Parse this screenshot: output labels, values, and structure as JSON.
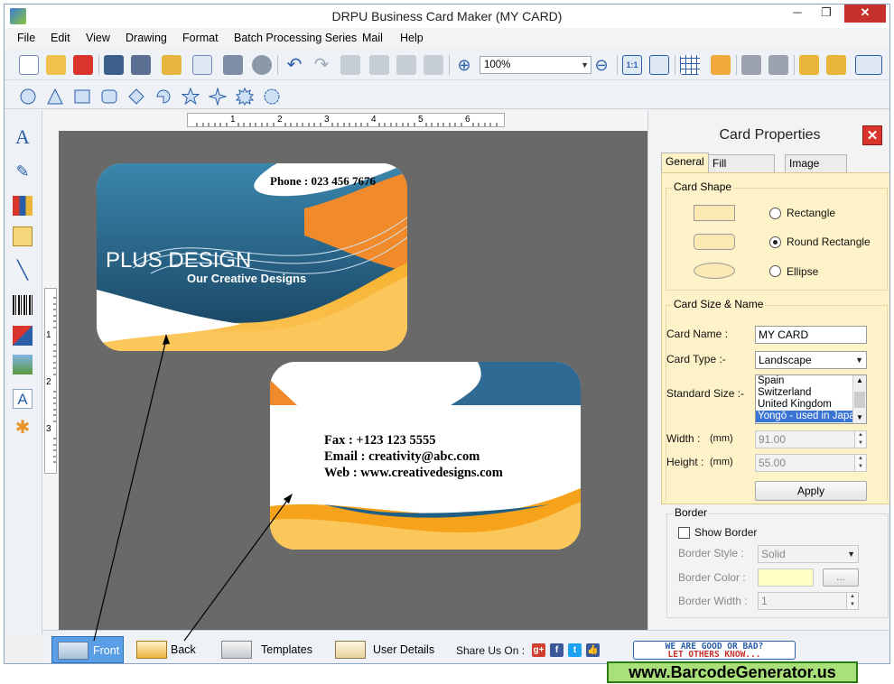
{
  "window": {
    "title": "DRPU Business Card Maker (MY CARD)",
    "minimize": "─",
    "maximize": "❐",
    "close": "✕"
  },
  "menu": [
    "File",
    "Edit",
    "View",
    "Drawing",
    "Format",
    "Batch Processing Series",
    "Mail",
    "Help"
  ],
  "toolbar": {
    "zoom_value": "100%"
  },
  "canvas": {
    "ruler_top_numbers": [
      "1",
      "2",
      "3",
      "4",
      "5",
      "6"
    ],
    "ruler_left_numbers": [
      "1",
      "2",
      "3"
    ],
    "front_card": {
      "phone": "Phone : 023 456 7676",
      "company": "PLUS DESIGN",
      "tagline": "Our Creative Designs"
    },
    "back_card": {
      "fax": "Fax : +123 123 5555",
      "email": "Email : creativity@abc.com",
      "web": "Web : www.creativedesigns.com"
    }
  },
  "properties": {
    "title": "Card Properties",
    "close": "✕",
    "tabs": [
      "General",
      "Fill Background",
      "Image Processing"
    ],
    "card_shape": {
      "label": "Card Shape",
      "options": [
        "Rectangle",
        "Round Rectangle",
        "Ellipse"
      ],
      "selected": "Round Rectangle"
    },
    "size_name": {
      "label": "Card Size & Name",
      "card_name_label": "Card Name :",
      "card_name_value": "MY CARD",
      "card_type_label": "Card Type :-",
      "card_type_value": "Landscape",
      "standard_size_label": "Standard Size :-",
      "standard_sizes": [
        "Spain",
        "Switzerland",
        "United Kingdom",
        "Yongō - used in Japan"
      ],
      "standard_size_selected": "Yongō - used in Japan",
      "width_label": "Width :",
      "width_unit": "(mm)",
      "width_value": "91.00",
      "height_label": "Height :",
      "height_unit": "(mm)",
      "height_value": "55.00",
      "apply": "Apply"
    },
    "border": {
      "label": "Border",
      "show_border": "Show Border",
      "style_label": "Border Style :",
      "style_value": "Solid",
      "color_label": "Border Color :",
      "color_button": "...",
      "width_label": "Border Width :",
      "width_value": "1"
    }
  },
  "bottombar": {
    "front": "Front",
    "back": "Back",
    "templates": "Templates",
    "user_details": "User Details",
    "share_label": "Share Us On :",
    "feedback_line1": "WE ARE GOOD OR BAD?",
    "feedback_line2": "LET OTHERS KNOW..."
  },
  "banner": "www.BarcodeGenerator.us",
  "colors": {
    "card_blue": "#1f5f86",
    "card_orange": "#f7a21b",
    "accent_selection": "#3b75d3",
    "panel_yellow": "#fdf2c8"
  }
}
